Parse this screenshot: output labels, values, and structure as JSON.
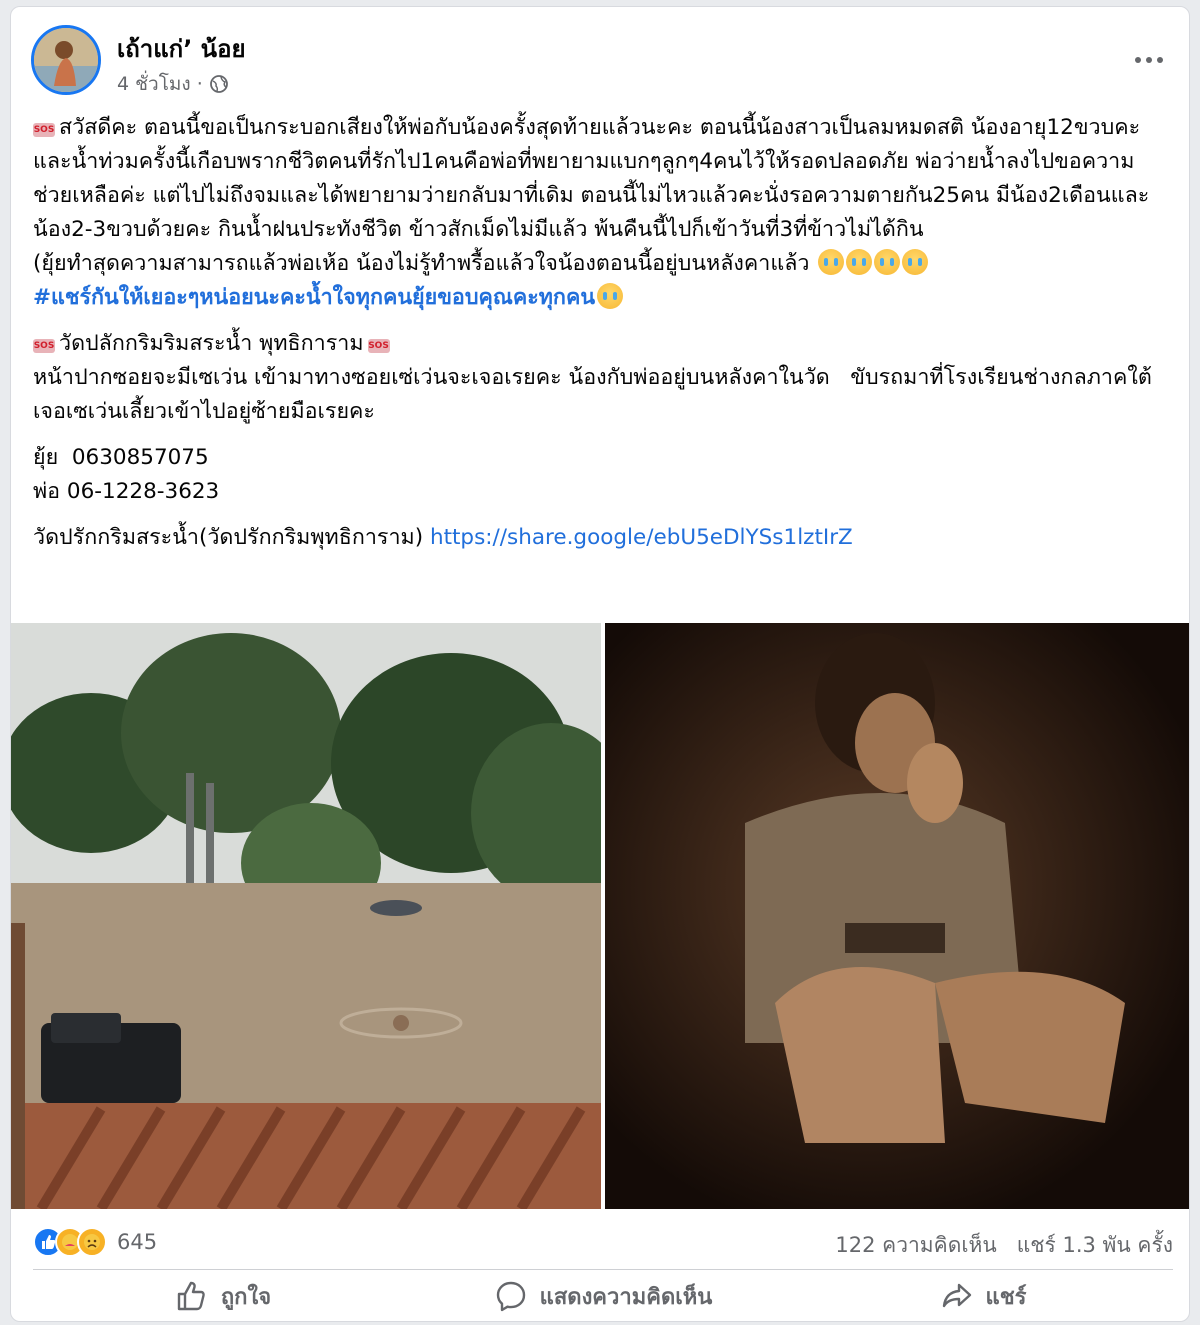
{
  "post": {
    "author": "เถ้าแก่’ น้อย",
    "time": "4 ชั่วโมง",
    "separator": "·",
    "sos_label": "SOS",
    "paragraph1": "สวัสดีคะ ตอนนี้ขอเป็นกระบอกเสียงให้พ่อกับน้องครั้งสุดท้ายแล้วนะคะ ตอนนี้น้องสาวเป็นลมหมดสติ น้องอายุ12ขวบคะและน้ำท่วมครั้งนี้เกือบพรากชีวิตคนที่รักไป1คนคือพ่อที่พยายามแบกๆลูกๆ4คนไว้ให้รอดปลอดภัย พ่อว่ายน้ำลงไปขอความช่วยเหลือค่ะ แต่ไปไม่ถึงจมและได้พยายามว่ายกลับมาที่เดิม ตอนนี้ไม่ไหวแล้วคะนั่งรอความตายกัน25คน มีน้อง2เดือนและน้อง2-3ขวบด้วยคะ กินน้ำฝนประทังชีวิต ข้าวสักเม็ดไม่มีแล้ว พ้นคืนนี้ไปก็เข้าวันที่3ที่ข้าวไม่ได้กิน",
    "paragraph2": "(ยุ้ยทำสุดความสามารถแล้วพ่อเห้อ น้องไม่รู้ทำพรื้อแล้วใจน้องตอนนี้อยู่บนหลังคาแล้ว",
    "hashtag": "#แชร์กันให้เยอะๆหน่อยนะคะน้ำใจทุกคนยุ้ยขอบคุณคะทุกคน",
    "location_title": "วัดปลักกริมริมสระน้ำ พุทธิการาม",
    "directions": "หน้าปากซอยจะมีเซเว่น เข้ามาทางซอยเซ่เว่นจะเจอเรยคะ น้องกับพ่ออยู่บนหลังคาในวัด   ขับรถมาที่โรงเรียนช่างกลภาคใต้เจอเซเว่นเลี้ยวเข้าไปอยู่ซ้ายมือเรยคะ",
    "contact1": "ยุ้ย  0630857075",
    "contact2": "พ่อ 06-1228-3623",
    "map_label": "วัดปรักกริมสระน้ำ(วัดปรักกริมพุทธิการาม)",
    "map_link": "https://share.google/ebU5eDlYSs1lztIrZ"
  },
  "stats": {
    "reaction_count": "645",
    "comments": "122 ความคิดเห็น",
    "shares": "แชร์ 1.3 พัน ครั้ง"
  },
  "actions": {
    "like": "ถูกใจ",
    "comment": "แสดงความคิดเห็น",
    "share": "แชร์"
  },
  "icons": {
    "more": "more-options-icon",
    "privacy": "globe-icon",
    "like": "thumbs-up-icon",
    "comment": "speech-bubble-icon",
    "share": "share-arrow-icon"
  },
  "colors": {
    "link": "#216fdb",
    "like_blue": "#1877f2",
    "muted": "#65676b"
  }
}
